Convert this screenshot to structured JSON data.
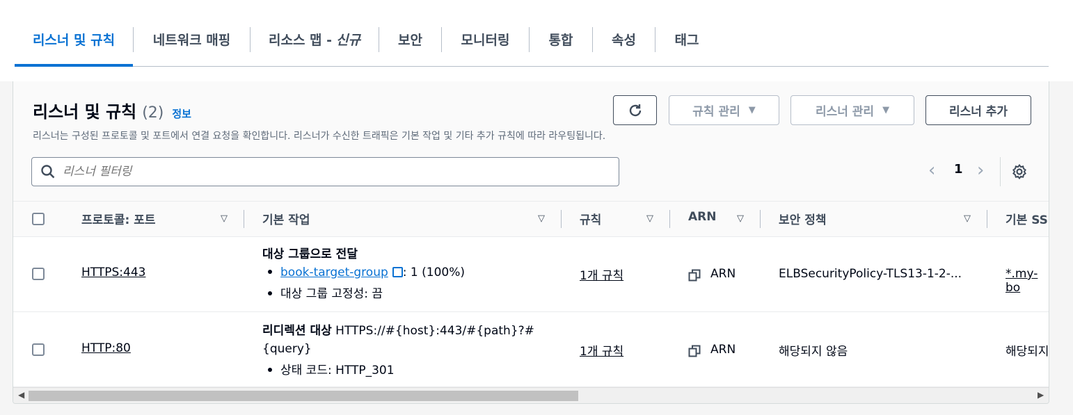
{
  "tabs": [
    {
      "label": "리스너 및 규칙"
    },
    {
      "label": "네트워크 매핑"
    },
    {
      "label": "리소스 맵 -",
      "badge": "신규"
    },
    {
      "label": "보안"
    },
    {
      "label": "모니터링"
    },
    {
      "label": "통합"
    },
    {
      "label": "속성"
    },
    {
      "label": "태그"
    }
  ],
  "panel": {
    "title": "리스너 및 규칙",
    "count": "(2)",
    "info_link": "정보",
    "description": "리스너는 구성된 프로토콜 및 포트에서 연결 요청을 확인합니다. 리스너가 수신한 트래픽은 기본 작업 및 기타 추가 규칙에 따라 라우팅됩니다.",
    "buttons": {
      "manage_rules": "규칙 관리",
      "manage_listener": "리스너 관리",
      "add_listener": "리스너 추가"
    },
    "search_placeholder": "리스너 필터링",
    "page": "1"
  },
  "table": {
    "headers": [
      "프로토콜: 포트",
      "기본 작업",
      "규칙",
      "ARN",
      "보안 정책",
      "기본 SS"
    ],
    "rows": [
      {
        "protocol": "HTTPS:443",
        "action_title": "대상 그룹으로 전달",
        "action_link": "book-target-group",
        "action_link_suffix": ": 1 (100%)",
        "action_bullet2": "대상 그룹 고정성: 끔",
        "rules": "1개 규칙",
        "arn": "ARN",
        "security_policy": "ELBSecurityPolicy-TLS13-1-2-...",
        "default_ssl": "*.my-bo"
      },
      {
        "protocol": "HTTP:80",
        "action_title": "리디렉션 대상",
        "action_url_line1": "HTTPS://#{host}:443/#{path}?#",
        "action_url_line2": "{query}",
        "action_bullet": "상태 코드: HTTP_301",
        "rules": "1개 규칙",
        "arn": "ARN",
        "security_policy": "해당되지 않음",
        "default_ssl": "해당되지"
      }
    ]
  },
  "colors": {
    "accent": "#0972d3",
    "text": "#000716",
    "muted": "#5f6b7a"
  }
}
